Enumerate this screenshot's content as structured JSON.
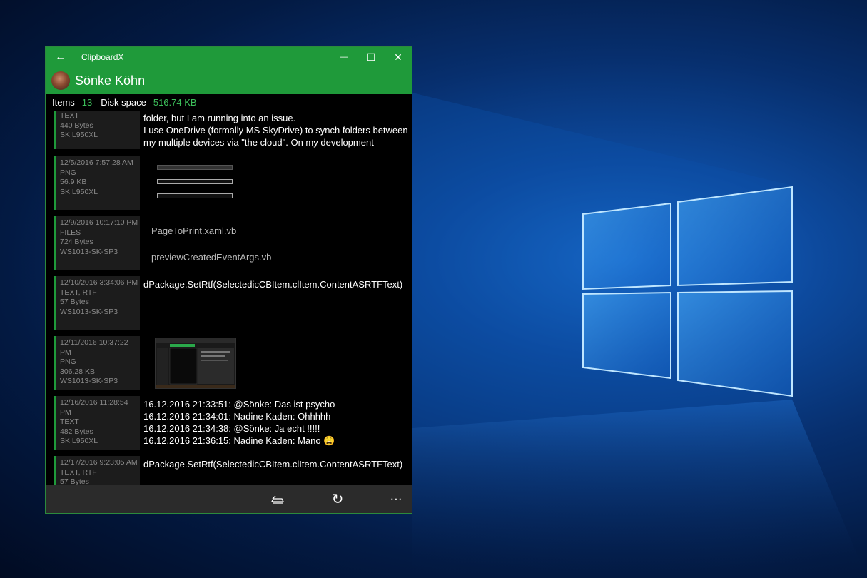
{
  "window": {
    "app_title": "ClipboardX",
    "back_icon": "←",
    "minimize_icon": "—",
    "maximize_icon": "☐",
    "close_icon": "✕"
  },
  "header": {
    "user_name": "Sönke Köhn"
  },
  "stats": {
    "items_label": "Items",
    "items_value": "13",
    "disk_label": "Disk space",
    "disk_value": "516.74 KB"
  },
  "items": [
    {
      "meta": [
        "TEXT",
        "440 Bytes",
        "SK L950XL"
      ],
      "lines": [
        "folder, but I am running into an issue.",
        "I use OneDrive (formally MS SkyDrive) to synch folders between",
        "my multiple devices via \"the cloud\". On my development"
      ]
    },
    {
      "meta": [
        "12/5/2016 7:57:28 AM",
        "PNG",
        "56.9 KB",
        "SK L950XL"
      ]
    },
    {
      "meta": [
        "12/9/2016 10:17:10 PM",
        "FILES",
        "724 Bytes",
        "WS1013-SK-SP3"
      ],
      "files": [
        "PageToPrint.xaml.vb",
        "previewCreatedEventArgs.vb"
      ]
    },
    {
      "meta": [
        "12/10/2016 3:34:06 PM",
        "TEXT, RTF",
        "57 Bytes",
        "WS1013-SK-SP3"
      ],
      "lines": [
        "dPackage.SetRtf(SelectedicCBItem.clItem.ContentASRTFText)"
      ]
    },
    {
      "meta": [
        "12/11/2016 10:37:22 PM",
        "PNG",
        "306.28 KB",
        "WS1013-SK-SP3"
      ]
    },
    {
      "meta": [
        "12/16/2016 11:28:54 PM",
        "TEXT",
        "482 Bytes",
        "SK L950XL"
      ],
      "lines": [
        "16.12.2016 21:33:51: @Sönke: Das ist psycho",
        "16.12.2016 21:34:01: Nadine Kaden: Ohhhhh",
        "16.12.2016 21:34:38: @Sönke: Ja echt !!!!!",
        "16.12.2016 21:36:15: Nadine Kaden: Mano 😩"
      ]
    },
    {
      "meta": [
        "12/17/2016 9:23:05 AM",
        "TEXT, RTF",
        "57 Bytes"
      ],
      "lines": [
        "dPackage.SetRtf(SelectedicCBItem.clItem.ContentASRTFText)"
      ]
    }
  ],
  "bottom_bar": {
    "clear_icon": "clear-clipboard-icon",
    "refresh_icon": "↻",
    "more_icon": "···"
  }
}
